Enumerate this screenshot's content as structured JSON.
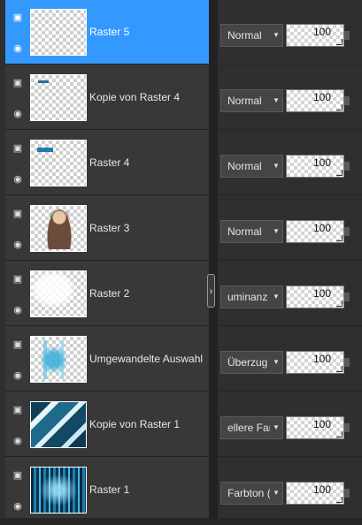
{
  "layers": [
    {
      "name": "Raster 5",
      "blend": "Normal",
      "opacity": "100",
      "selected": true,
      "thumb": "empty"
    },
    {
      "name": "Kopie von Raster 4",
      "blend": "Normal",
      "opacity": "100",
      "selected": false,
      "thumb": "tiny"
    },
    {
      "name": "Raster 4",
      "blend": "Normal",
      "opacity": "100",
      "selected": false,
      "thumb": "strip"
    },
    {
      "name": "Raster 3",
      "blend": "Normal",
      "opacity": "100",
      "selected": false,
      "thumb": "figure"
    },
    {
      "name": "Raster 2",
      "blend": "uminanz (\\",
      "opacity": "100",
      "selected": false,
      "thumb": "mask"
    },
    {
      "name": "Umgewandelte Auswahl",
      "blend": "Überzug",
      "opacity": "100",
      "selected": false,
      "thumb": "auswahl"
    },
    {
      "name": "Kopie von Raster 1",
      "blend": "ellere Farb",
      "opacity": "100",
      "selected": false,
      "thumb": "kopie1"
    },
    {
      "name": "Raster 1",
      "blend": "Farbton (V)",
      "opacity": "100",
      "selected": false,
      "thumb": "raster1"
    }
  ],
  "icons": {
    "group_icon": "layer-group-icon",
    "visibility_icon": "eye-icon",
    "dropdown_icon": "chevron-down-icon",
    "splitter_icon": "chevron-right-icon"
  },
  "colors": {
    "selected": "#3399ff",
    "panel": "#383838",
    "text": "#e8e8e8"
  },
  "splitter_glyph": "›"
}
